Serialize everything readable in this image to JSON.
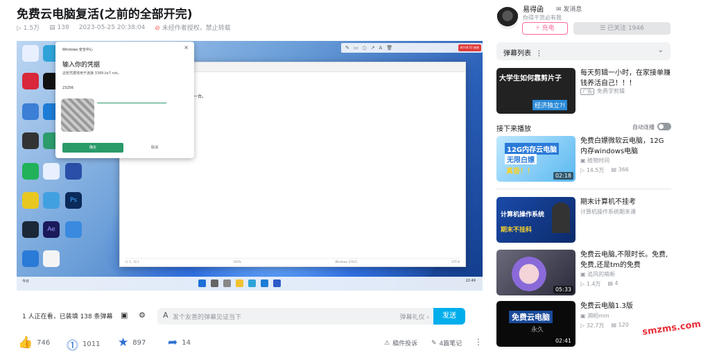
{
  "video": {
    "title": "免费云电脑复活(之前的全部开完)",
    "views": "1.5万",
    "danmaku_count": "138",
    "datetime": "2023-05-25 20:38:04",
    "copyright": "未经作者授权，禁止转载"
  },
  "player": {
    "security_dialog": {
      "window_title": "Windows 安全中心",
      "heading": "输入你的凭据",
      "subtitle": "这些凭据将用于连接 3389.lie7.net。",
      "username": "23256",
      "confirm": "确定",
      "cancel": "取消"
    },
    "notepad_text": "一人一台。",
    "notepad_status": [
      "行 1，列 1",
      "100%",
      "Windows (CRLF)",
      "UTF-8"
    ],
    "recording_badge": "00:00:51 结束",
    "taskbar_weather": "今日",
    "taskbar_time": "22:49",
    "desktop_icons": [
      "回收站",
      "Microsoft Edge",
      "AutoCAD 2023",
      "QQ",
      "Krita",
      "Foxit",
      "Clash",
      "OBS Studio",
      "PyCharm",
      "Wallpaper Engine",
      "Photoshop",
      "Adobe Premiere",
      "Steam",
      "Adobe After Effects",
      "Tencent",
      "Feishu"
    ]
  },
  "controls": {
    "viewers": "1 人正在看，已装填 138 条弹幕",
    "danmaku_placeholder": "发个友善的弹幕见证当下",
    "danmaku_etiquette": "弹幕礼仪 ›",
    "send": "发送"
  },
  "actions": {
    "like": "746",
    "coin": "1011",
    "favorite": "897",
    "share": "14",
    "report": "稿件投诉",
    "notes": "4篇笔记"
  },
  "uploader": {
    "name": "易得函",
    "message": "发消息",
    "signature": "你得干货必有我",
    "charge": "充电",
    "followed": "已关注 1946"
  },
  "sidebar": {
    "danmaku_list": "弹幕列表",
    "next_up": "接下来播放",
    "autoplay": "自动连播",
    "cards": [
      {
        "title": "每天剪辑一小时，在家接单赚钱养活自己！！！",
        "author": "免费学剪辑",
        "ad": "广告",
        "thumb_text": "大学生如何靠剪片子",
        "thumb_text2": "经济独立?!"
      },
      {
        "title": "免费白嫖微软云电脑，12G内存windows电脑",
        "author": "植物时间",
        "views": "14.5万",
        "danmaku": "366",
        "duration": "02:18",
        "thumb_text": "12G内存云电脑",
        "thumb_text2": "无限白嫖",
        "thumb_text3": "真香！！"
      },
      {
        "title": "期末计算机不挂考",
        "author": "计算机操作系统期末课",
        "thumb_text": "计算机操作系统",
        "thumb_text2": "期末不挂科"
      },
      {
        "title": "免费云电脑,不限时长。免费,免费,还是tm的免费",
        "author": "追风的萌新",
        "views": "1.4万",
        "danmaku": "4",
        "duration": "05:33"
      },
      {
        "title": "免费云电脑1.3版",
        "author": "溯昭mm",
        "views": "32.7万",
        "danmaku": "120",
        "duration": "02:41",
        "thumb_text": "免费云电脑",
        "thumb_text2": "永久"
      }
    ]
  },
  "watermark": "smzms.com"
}
